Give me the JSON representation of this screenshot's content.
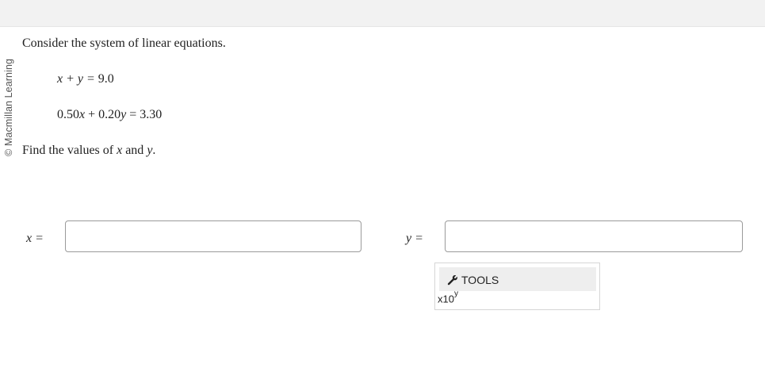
{
  "watermark": "© Macmillan Learning",
  "question": {
    "prompt": "Consider the system of linear equations.",
    "eq1": {
      "left": "x + y = ",
      "right": "9.0"
    },
    "eq2": {
      "a": "0.50",
      "x": "x",
      "b": " + 0.20",
      "y": "y",
      "rhs": " = 3.30"
    },
    "find": {
      "pre": "Find the values of ",
      "v1": "x",
      "mid": " and ",
      "v2": "y",
      "post": "."
    }
  },
  "answers": {
    "x_label": "x =",
    "x_value": "",
    "y_label": "y =",
    "y_value": ""
  },
  "tools": {
    "icon": "wrench-icon",
    "label": "TOOLS",
    "sci_base": "x10",
    "sci_exp": "y"
  }
}
